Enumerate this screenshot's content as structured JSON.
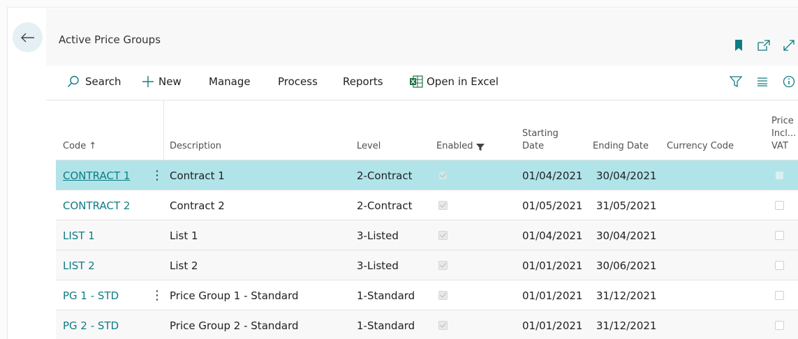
{
  "page": {
    "title": "Active Price Groups"
  },
  "actions": {
    "search": "Search",
    "new": "New",
    "manage": "Manage",
    "process": "Process",
    "reports": "Reports",
    "open_in_excel": "Open in Excel"
  },
  "columns": {
    "code": "Code ↑",
    "description": "Description",
    "level": "Level",
    "enabled": "Enabled",
    "starting_date_1": "Starting",
    "starting_date_2": "Date",
    "ending_date": "Ending Date",
    "currency_code": "Currency Code",
    "price_vat_1": "Price",
    "price_vat_2": "Incl...",
    "price_vat_3": "VAT"
  },
  "rows": [
    {
      "code": "CONTRACT 1",
      "description": "Contract 1",
      "level": "2-Contract",
      "enabled": true,
      "starting_date": "01/04/2021",
      "ending_date": "30/04/2021",
      "currency_code": "",
      "price_incl_vat": false
    },
    {
      "code": "CONTRACT 2",
      "description": "Contract 2",
      "level": "2-Contract",
      "enabled": true,
      "starting_date": "01/05/2021",
      "ending_date": "31/05/2021",
      "currency_code": "",
      "price_incl_vat": false
    },
    {
      "code": "LIST 1",
      "description": "List 1",
      "level": "3-Listed",
      "enabled": true,
      "starting_date": "01/04/2021",
      "ending_date": "30/04/2021",
      "currency_code": "",
      "price_incl_vat": false
    },
    {
      "code": "LIST 2",
      "description": "List 2",
      "level": "3-Listed",
      "enabled": true,
      "starting_date": "01/01/2021",
      "ending_date": "30/06/2021",
      "currency_code": "",
      "price_incl_vat": false
    },
    {
      "code": "PG 1 - STD",
      "description": "Price Group 1 - Standard",
      "level": "1-Standard",
      "enabled": true,
      "starting_date": "01/01/2021",
      "ending_date": "31/12/2021",
      "currency_code": "",
      "price_incl_vat": false
    },
    {
      "code": "PG 2 - STD",
      "description": "Price Group 2 - Standard",
      "level": "1-Standard",
      "enabled": true,
      "starting_date": "01/01/2021",
      "ending_date": "31/12/2021",
      "currency_code": "",
      "price_incl_vat": false
    }
  ],
  "icons": {
    "back": "back-arrow-icon",
    "bookmark": "bookmark-icon",
    "open_new": "open-in-new-window-icon",
    "expand": "expand-icon",
    "search": "search-icon",
    "new": "plus-icon",
    "excel": "excel-icon",
    "filter": "filter-icon",
    "list": "list-view-icon",
    "info": "info-icon"
  },
  "colors": {
    "accent": "#0f7c84",
    "selected_row": "#b0e4e9",
    "back_button": "#e4f0f3"
  }
}
